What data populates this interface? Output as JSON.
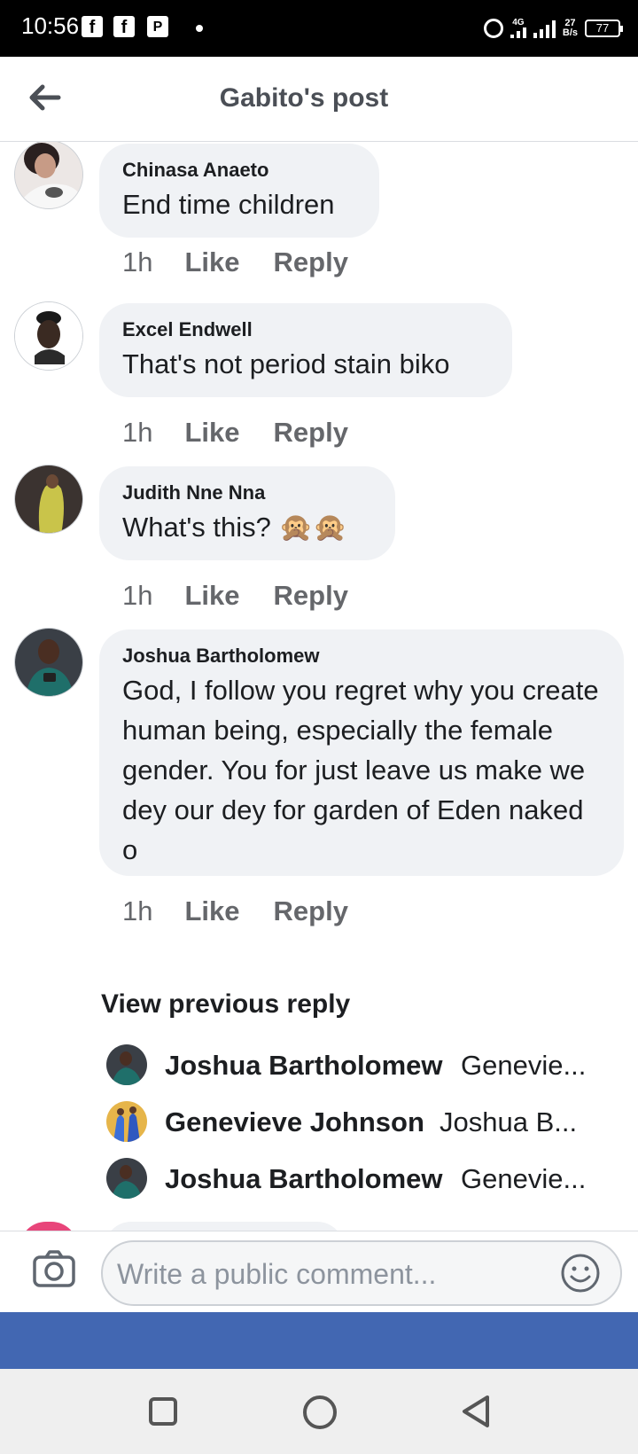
{
  "status_bar": {
    "time": "10:56",
    "notification_icons": [
      "f",
      "f",
      "P"
    ],
    "network": "4G",
    "net_speed_value": "27",
    "net_speed_unit": "B/s",
    "battery": "77"
  },
  "header": {
    "title": "Gabito's post"
  },
  "comments": [
    {
      "author": "Chinasa Anaeto",
      "text": "End time children",
      "time": "1h",
      "like": "Like",
      "reply": "Reply"
    },
    {
      "author": "Excel Endwell",
      "text": "That's not period  stain biko",
      "time": "1h",
      "like": "Like",
      "reply": "Reply"
    },
    {
      "author": "Judith Nne Nna",
      "text": "What's this? 🙊🙊",
      "time": "1h",
      "like": "Like",
      "reply": "Reply"
    },
    {
      "author": "Joshua Bartholomew",
      "text": "God, I follow you regret why you create human being, especially the female gender. You for just leave us make we dey our dey for garden of Eden naked o",
      "time": "1h",
      "like": "Like",
      "reply": "Reply"
    }
  ],
  "replies": {
    "view_previous": "View previous reply",
    "items": [
      {
        "name": "Joshua Bartholomew",
        "preview": "Genevie..."
      },
      {
        "name": "Genevieve Johnson",
        "preview": "Joshua B..."
      },
      {
        "name": "Joshua Bartholomew",
        "preview": "Genevie..."
      }
    ]
  },
  "composer": {
    "placeholder": "Write a public comment..."
  },
  "colors": {
    "facebook_blue": "#4267b2",
    "bubble_bg": "#f0f2f5",
    "meta_text": "#65676b"
  }
}
